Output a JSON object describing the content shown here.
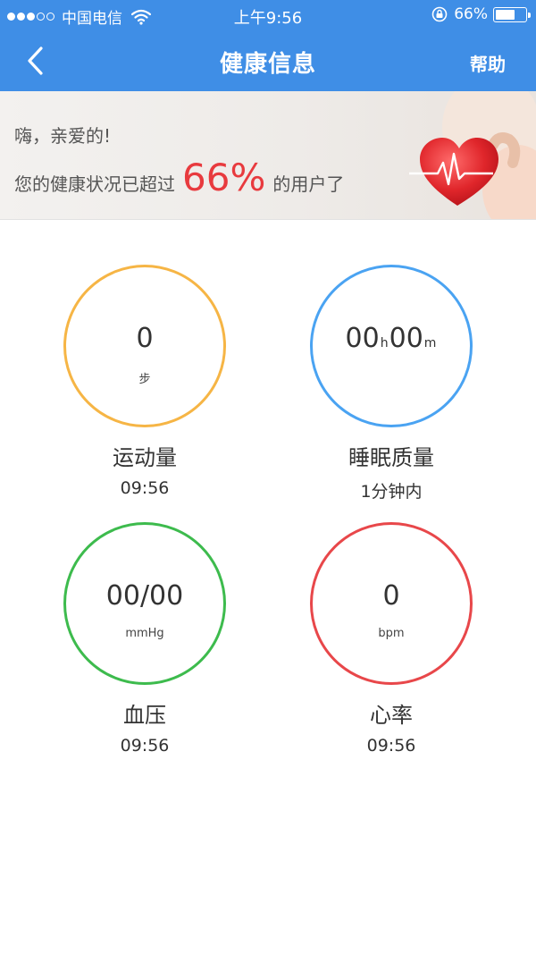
{
  "status_bar": {
    "carrier": "中国电信",
    "time": "上午9:56",
    "battery_percent": "66%",
    "battery_level": 0.66,
    "icons": [
      "signal-dots-icon",
      "wifi-icon",
      "rotation-lock-icon",
      "battery-icon"
    ]
  },
  "nav": {
    "title": "健康信息",
    "help_label": "帮助",
    "back_icon": "back-chevron-icon"
  },
  "banner": {
    "greeting": "嗨，亲爱的!",
    "prefix": "您的健康状况已超过",
    "percent": "66%",
    "suffix": "的用户了",
    "art": "heart-with-pulse-icon"
  },
  "colors": {
    "brand": "#3f8ee6",
    "steps": "#f6b545",
    "sleep": "#4aa3f2",
    "blood_pressure": "#3dbb4d",
    "heart_rate": "#e8474a",
    "highlight": "#e83a3e"
  },
  "metrics": {
    "steps": {
      "value": "0",
      "unit": "步",
      "label": "运动量",
      "time": "09:56"
    },
    "sleep": {
      "hours": "00",
      "h_unit": "h",
      "minutes": "00",
      "m_unit": "m",
      "label": "睡眠质量",
      "time": "1分钟内"
    },
    "blood_pressure": {
      "value": "00/00",
      "unit": "mmHg",
      "label": "血压",
      "time": "09:56"
    },
    "heart_rate": {
      "value": "0",
      "unit": "bpm",
      "label": "心率",
      "time": "09:56"
    }
  }
}
